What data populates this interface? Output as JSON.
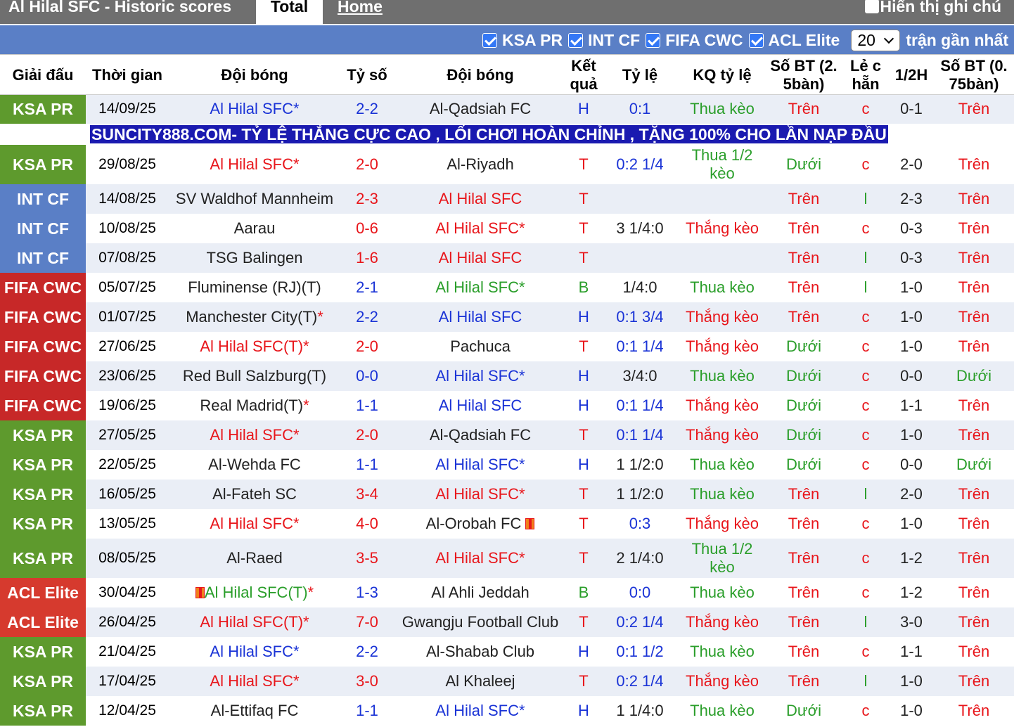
{
  "header": {
    "title": "Al Hilal SFC - Historic scores",
    "tab_total": "Total",
    "tab_home": "Home",
    "show_notes": "Hiển thị ghi chú"
  },
  "filters": {
    "items": [
      "KSA PR",
      "INT CF",
      "FIFA CWC",
      "ACL Elite"
    ],
    "count": "20",
    "count_suffix": "trận gần nhất"
  },
  "columns": [
    "Giải đấu",
    "Thời gian",
    "Đội bóng",
    "Tỷ số",
    "Đội bóng",
    "Kết quả",
    "Tỷ lệ",
    "KQ tỷ lệ",
    "Số BT (2. 5bàn)",
    "Lẻ c hẵn",
    "1/2H",
    "Số BT (0. 75bàn)"
  ],
  "banner": "SUNCITY888.COM- TỶ LỆ THẮNG CỰC CAO , LỐI CHƠI HOÀN CHỈNH , TẶNG 100% CHO LẦN NẠP ĐẦU",
  "colors": {
    "ksa": "#5e9a2d",
    "int": "#5a7fc6",
    "fifa": "#c72828",
    "acl": "#d63a2e"
  },
  "rows": [
    {
      "comp": "KSA PR",
      "date": "14/09/25",
      "home": "Al Hilal SFC*",
      "score": "2-2",
      "away": "Al-Qadsiah FC",
      "res": "H",
      "odds": "0:1",
      "oddsres": "Thua kèo",
      "ou": "Trên",
      "oe": "c",
      "half": "0-1",
      "ou2": "Trên"
    },
    {
      "comp": "KSA PR",
      "date": "29/08/25",
      "home": "Al Hilal SFC*",
      "score": "2-0",
      "away": "Al-Riyadh",
      "res": "T",
      "odds": "0:2 1/4",
      "oddsres": "Thua 1/2 kèo",
      "ou": "Dưới",
      "oe": "c",
      "half": "2-0",
      "ou2": "Trên"
    },
    {
      "comp": "INT CF",
      "date": "14/08/25",
      "home": "SV Waldhof Mannheim",
      "score": "2-3",
      "away": "Al Hilal SFC",
      "res": "T",
      "odds": "",
      "oddsres": "",
      "ou": "Trên",
      "oe": "l",
      "half": "2-3",
      "ou2": "Trên"
    },
    {
      "comp": "INT CF",
      "date": "10/08/25",
      "home": "Aarau",
      "score": "0-6",
      "away": "Al Hilal SFC*",
      "res": "T",
      "odds": "3 1/4:0",
      "oddsres": "Thắng kèo",
      "ou": "Trên",
      "oe": "c",
      "half": "0-3",
      "ou2": "Trên"
    },
    {
      "comp": "INT CF",
      "date": "07/08/25",
      "home": "TSG Balingen",
      "score": "1-6",
      "away": "Al Hilal SFC",
      "res": "T",
      "odds": "",
      "oddsres": "",
      "ou": "Trên",
      "oe": "l",
      "half": "0-3",
      "ou2": "Trên"
    },
    {
      "comp": "FIFA CWC",
      "date": "05/07/25",
      "home": "Fluminense (RJ)(T)",
      "score": "2-1",
      "away": "Al Hilal SFC*",
      "res": "B",
      "odds": "1/4:0",
      "oddsres": "Thua kèo",
      "ou": "Trên",
      "oe": "l",
      "half": "1-0",
      "ou2": "Trên"
    },
    {
      "comp": "FIFA CWC",
      "date": "01/07/25",
      "home": "Manchester City(T)",
      "home_star": "*",
      "score": "2-2",
      "away": "Al Hilal SFC",
      "res": "H",
      "odds": "0:1 3/4",
      "oddsres": "Thắng kèo",
      "ou": "Trên",
      "oe": "c",
      "half": "1-0",
      "ou2": "Trên"
    },
    {
      "comp": "FIFA CWC",
      "date": "27/06/25",
      "home": "Al Hilal SFC(T)",
      "home_star": "*",
      "score": "2-0",
      "away": "Pachuca",
      "res": "T",
      "odds": "0:1 1/4",
      "oddsres": "Thắng kèo",
      "ou": "Dưới",
      "oe": "c",
      "half": "1-0",
      "ou2": "Trên"
    },
    {
      "comp": "FIFA CWC",
      "date": "23/06/25",
      "home": "Red Bull Salzburg(T)",
      "score": "0-0",
      "away": "Al Hilal SFC*",
      "res": "H",
      "odds": "3/4:0",
      "oddsres": "Thua kèo",
      "ou": "Dưới",
      "oe": "c",
      "half": "0-0",
      "ou2": "Dưới"
    },
    {
      "comp": "FIFA CWC",
      "date": "19/06/25",
      "home": "Real Madrid(T)",
      "home_star": "*",
      "score": "1-1",
      "away": "Al Hilal SFC",
      "res": "H",
      "odds": "0:1 1/4",
      "oddsres": "Thắng kèo",
      "ou": "Dưới",
      "oe": "c",
      "half": "1-1",
      "ou2": "Trên"
    },
    {
      "comp": "KSA PR",
      "date": "27/05/25",
      "home": "Al Hilal SFC*",
      "score": "2-0",
      "away": "Al-Qadsiah FC",
      "res": "T",
      "odds": "0:1 1/4",
      "oddsres": "Thắng kèo",
      "ou": "Dưới",
      "oe": "c",
      "half": "1-0",
      "ou2": "Trên"
    },
    {
      "comp": "KSA PR",
      "date": "22/05/25",
      "home": "Al-Wehda FC",
      "score": "1-1",
      "away": "Al Hilal SFC*",
      "res": "H",
      "odds": "1 1/2:0",
      "oddsres": "Thua kèo",
      "ou": "Dưới",
      "oe": "c",
      "half": "0-0",
      "ou2": "Dưới"
    },
    {
      "comp": "KSA PR",
      "date": "16/05/25",
      "home": "Al-Fateh SC",
      "score": "3-4",
      "away": "Al Hilal SFC*",
      "res": "T",
      "odds": "1 1/2:0",
      "oddsres": "Thua kèo",
      "ou": "Trên",
      "oe": "l",
      "half": "2-0",
      "ou2": "Trên"
    },
    {
      "comp": "KSA PR",
      "date": "13/05/25",
      "home": "Al Hilal SFC*",
      "score": "4-0",
      "away": "Al-Orobah FC",
      "away_flag": true,
      "res": "T",
      "odds": "0:3",
      "oddsres": "Thắng kèo",
      "ou": "Trên",
      "oe": "c",
      "half": "1-0",
      "ou2": "Trên"
    },
    {
      "comp": "KSA PR",
      "date": "08/05/25",
      "home": "Al-Raed",
      "score": "3-5",
      "away": "Al Hilal SFC*",
      "res": "T",
      "odds": "2 1/4:0",
      "oddsres": "Thua 1/2 kèo",
      "ou": "Trên",
      "oe": "c",
      "half": "1-2",
      "ou2": "Trên"
    },
    {
      "comp": "ACL Elite",
      "date": "30/04/25",
      "home": "Al Hilal SFC(T)",
      "home_star": "*",
      "home_flag": true,
      "score": "1-3",
      "away": "Al Ahli Jeddah",
      "res": "B",
      "odds": "0:0",
      "oddsres": "Thua kèo",
      "ou": "Trên",
      "oe": "c",
      "half": "1-2",
      "ou2": "Trên"
    },
    {
      "comp": "ACL Elite",
      "date": "26/04/25",
      "home": "Al Hilal SFC(T)",
      "home_star": "*",
      "score": "7-0",
      "away": "Gwangju Football Club",
      "res": "T",
      "odds": "0:2 1/4",
      "oddsres": "Thắng kèo",
      "ou": "Trên",
      "oe": "l",
      "half": "3-0",
      "ou2": "Trên"
    },
    {
      "comp": "KSA PR",
      "date": "21/04/25",
      "home": "Al Hilal SFC*",
      "score": "2-2",
      "away": "Al-Shabab Club",
      "res": "H",
      "odds": "0:1 1/2",
      "oddsres": "Thua kèo",
      "ou": "Trên",
      "oe": "c",
      "half": "1-1",
      "ou2": "Trên"
    },
    {
      "comp": "KSA PR",
      "date": "17/04/25",
      "home": "Al Hilal SFC*",
      "score": "3-0",
      "away": "Al Khaleej",
      "res": "T",
      "odds": "0:2 1/4",
      "oddsres": "Thắng kèo",
      "ou": "Trên",
      "oe": "l",
      "half": "1-0",
      "ou2": "Trên"
    },
    {
      "comp": "KSA PR",
      "date": "12/04/25",
      "home": "Al-Ettifaq FC",
      "score": "1-1",
      "away": "Al Hilal SFC*",
      "res": "H",
      "odds": "1 1/4:0",
      "oddsres": "Thua kèo",
      "ou": "Dưới",
      "oe": "c",
      "half": "1-0",
      "ou2": "Trên"
    }
  ]
}
